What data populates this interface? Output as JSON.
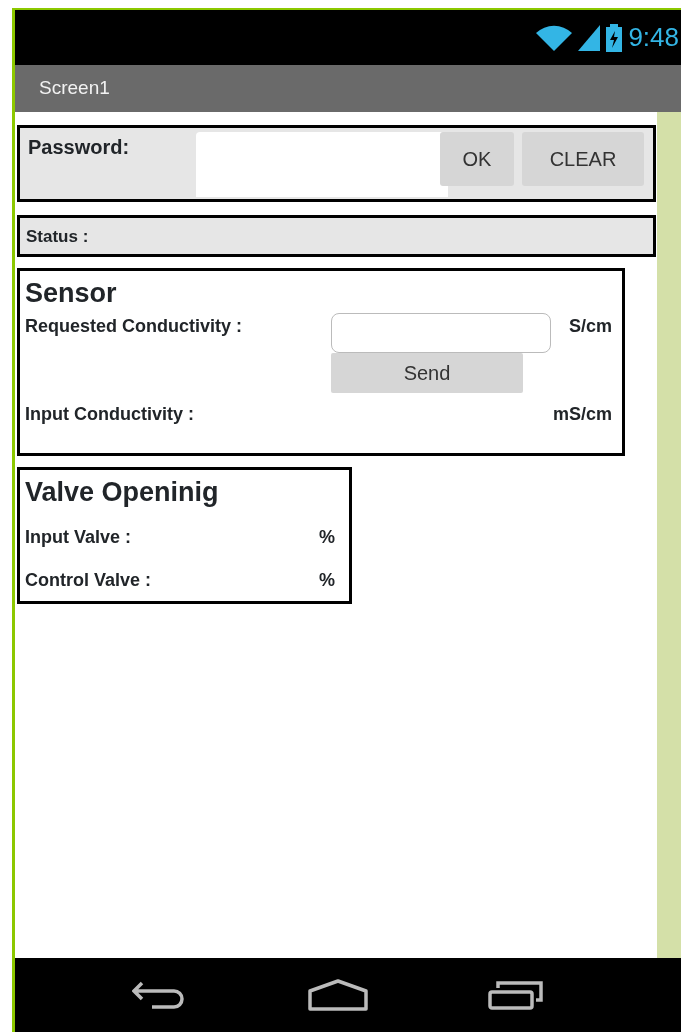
{
  "status_bar": {
    "time": "9:48"
  },
  "title_bar": {
    "title": "Screen1"
  },
  "password_row": {
    "label": "Password:",
    "buttons": [
      "OK",
      "CLEAR"
    ]
  },
  "status_row": {
    "label": "Status :"
  },
  "sensor": {
    "title": "Sensor",
    "requested_label": "Requested Conductivity :",
    "requested_unit": "S/cm",
    "send_button": "Send",
    "input_label": "Input Conductivity :",
    "input_unit": "mS/cm"
  },
  "valve": {
    "title": "Valve Openinig",
    "rows": [
      {
        "label": "Input Valve :",
        "unit": "%"
      },
      {
        "label": "Control Valve :",
        "unit": "%"
      }
    ]
  }
}
